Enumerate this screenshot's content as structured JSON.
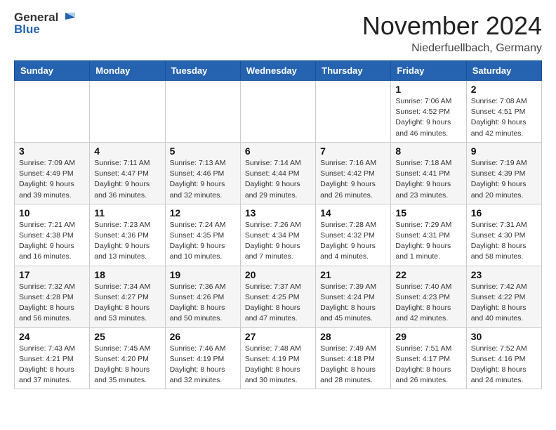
{
  "header": {
    "logo_general": "General",
    "logo_blue": "Blue",
    "title": "November 2024",
    "location": "Niederfuellbach, Germany"
  },
  "weekdays": [
    "Sunday",
    "Monday",
    "Tuesday",
    "Wednesday",
    "Thursday",
    "Friday",
    "Saturday"
  ],
  "weeks": [
    [
      {
        "day": "",
        "sunrise": "",
        "sunset": "",
        "daylight": ""
      },
      {
        "day": "",
        "sunrise": "",
        "sunset": "",
        "daylight": ""
      },
      {
        "day": "",
        "sunrise": "",
        "sunset": "",
        "daylight": ""
      },
      {
        "day": "",
        "sunrise": "",
        "sunset": "",
        "daylight": ""
      },
      {
        "day": "",
        "sunrise": "",
        "sunset": "",
        "daylight": ""
      },
      {
        "day": "1",
        "sunrise": "Sunrise: 7:06 AM",
        "sunset": "Sunset: 4:52 PM",
        "daylight": "Daylight: 9 hours and 46 minutes."
      },
      {
        "day": "2",
        "sunrise": "Sunrise: 7:08 AM",
        "sunset": "Sunset: 4:51 PM",
        "daylight": "Daylight: 9 hours and 42 minutes."
      }
    ],
    [
      {
        "day": "3",
        "sunrise": "Sunrise: 7:09 AM",
        "sunset": "Sunset: 4:49 PM",
        "daylight": "Daylight: 9 hours and 39 minutes."
      },
      {
        "day": "4",
        "sunrise": "Sunrise: 7:11 AM",
        "sunset": "Sunset: 4:47 PM",
        "daylight": "Daylight: 9 hours and 36 minutes."
      },
      {
        "day": "5",
        "sunrise": "Sunrise: 7:13 AM",
        "sunset": "Sunset: 4:46 PM",
        "daylight": "Daylight: 9 hours and 32 minutes."
      },
      {
        "day": "6",
        "sunrise": "Sunrise: 7:14 AM",
        "sunset": "Sunset: 4:44 PM",
        "daylight": "Daylight: 9 hours and 29 minutes."
      },
      {
        "day": "7",
        "sunrise": "Sunrise: 7:16 AM",
        "sunset": "Sunset: 4:42 PM",
        "daylight": "Daylight: 9 hours and 26 minutes."
      },
      {
        "day": "8",
        "sunrise": "Sunrise: 7:18 AM",
        "sunset": "Sunset: 4:41 PM",
        "daylight": "Daylight: 9 hours and 23 minutes."
      },
      {
        "day": "9",
        "sunrise": "Sunrise: 7:19 AM",
        "sunset": "Sunset: 4:39 PM",
        "daylight": "Daylight: 9 hours and 20 minutes."
      }
    ],
    [
      {
        "day": "10",
        "sunrise": "Sunrise: 7:21 AM",
        "sunset": "Sunset: 4:38 PM",
        "daylight": "Daylight: 9 hours and 16 minutes."
      },
      {
        "day": "11",
        "sunrise": "Sunrise: 7:23 AM",
        "sunset": "Sunset: 4:36 PM",
        "daylight": "Daylight: 9 hours and 13 minutes."
      },
      {
        "day": "12",
        "sunrise": "Sunrise: 7:24 AM",
        "sunset": "Sunset: 4:35 PM",
        "daylight": "Daylight: 9 hours and 10 minutes."
      },
      {
        "day": "13",
        "sunrise": "Sunrise: 7:26 AM",
        "sunset": "Sunset: 4:34 PM",
        "daylight": "Daylight: 9 hours and 7 minutes."
      },
      {
        "day": "14",
        "sunrise": "Sunrise: 7:28 AM",
        "sunset": "Sunset: 4:32 PM",
        "daylight": "Daylight: 9 hours and 4 minutes."
      },
      {
        "day": "15",
        "sunrise": "Sunrise: 7:29 AM",
        "sunset": "Sunset: 4:31 PM",
        "daylight": "Daylight: 9 hours and 1 minute."
      },
      {
        "day": "16",
        "sunrise": "Sunrise: 7:31 AM",
        "sunset": "Sunset: 4:30 PM",
        "daylight": "Daylight: 8 hours and 58 minutes."
      }
    ],
    [
      {
        "day": "17",
        "sunrise": "Sunrise: 7:32 AM",
        "sunset": "Sunset: 4:28 PM",
        "daylight": "Daylight: 8 hours and 56 minutes."
      },
      {
        "day": "18",
        "sunrise": "Sunrise: 7:34 AM",
        "sunset": "Sunset: 4:27 PM",
        "daylight": "Daylight: 8 hours and 53 minutes."
      },
      {
        "day": "19",
        "sunrise": "Sunrise: 7:36 AM",
        "sunset": "Sunset: 4:26 PM",
        "daylight": "Daylight: 8 hours and 50 minutes."
      },
      {
        "day": "20",
        "sunrise": "Sunrise: 7:37 AM",
        "sunset": "Sunset: 4:25 PM",
        "daylight": "Daylight: 8 hours and 47 minutes."
      },
      {
        "day": "21",
        "sunrise": "Sunrise: 7:39 AM",
        "sunset": "Sunset: 4:24 PM",
        "daylight": "Daylight: 8 hours and 45 minutes."
      },
      {
        "day": "22",
        "sunrise": "Sunrise: 7:40 AM",
        "sunset": "Sunset: 4:23 PM",
        "daylight": "Daylight: 8 hours and 42 minutes."
      },
      {
        "day": "23",
        "sunrise": "Sunrise: 7:42 AM",
        "sunset": "Sunset: 4:22 PM",
        "daylight": "Daylight: 8 hours and 40 minutes."
      }
    ],
    [
      {
        "day": "24",
        "sunrise": "Sunrise: 7:43 AM",
        "sunset": "Sunset: 4:21 PM",
        "daylight": "Daylight: 8 hours and 37 minutes."
      },
      {
        "day": "25",
        "sunrise": "Sunrise: 7:45 AM",
        "sunset": "Sunset: 4:20 PM",
        "daylight": "Daylight: 8 hours and 35 minutes."
      },
      {
        "day": "26",
        "sunrise": "Sunrise: 7:46 AM",
        "sunset": "Sunset: 4:19 PM",
        "daylight": "Daylight: 8 hours and 32 minutes."
      },
      {
        "day": "27",
        "sunrise": "Sunrise: 7:48 AM",
        "sunset": "Sunset: 4:19 PM",
        "daylight": "Daylight: 8 hours and 30 minutes."
      },
      {
        "day": "28",
        "sunrise": "Sunrise: 7:49 AM",
        "sunset": "Sunset: 4:18 PM",
        "daylight": "Daylight: 8 hours and 28 minutes."
      },
      {
        "day": "29",
        "sunrise": "Sunrise: 7:51 AM",
        "sunset": "Sunset: 4:17 PM",
        "daylight": "Daylight: 8 hours and 26 minutes."
      },
      {
        "day": "30",
        "sunrise": "Sunrise: 7:52 AM",
        "sunset": "Sunset: 4:16 PM",
        "daylight": "Daylight: 8 hours and 24 minutes."
      }
    ]
  ]
}
